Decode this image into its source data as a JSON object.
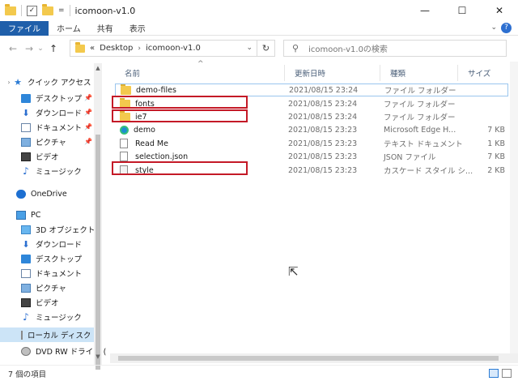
{
  "window": {
    "title": "icomoon-v1.0",
    "qat_arrow": "=",
    "minimize": "—",
    "maximize": "☐",
    "close": "✕"
  },
  "ribbon": {
    "tabs": [
      "ファイル",
      "ホーム",
      "共有",
      "表示"
    ],
    "collapse": "⌄",
    "help": "?"
  },
  "nav": {
    "back": "←",
    "forward": "→",
    "recent": "⌄",
    "up": "↑"
  },
  "address": {
    "overflow": "«",
    "crumbs": [
      "Desktop",
      "icomoon-v1.0"
    ],
    "separator": "›",
    "dropdown": "⌄",
    "refresh": "↻"
  },
  "search": {
    "icon": "⚲",
    "placeholder": "icomoon-v1.0の検索"
  },
  "sidebar": {
    "items": [
      {
        "label": "クイック アクセス",
        "icon": "star-icon",
        "chev": "›",
        "pin": ""
      },
      {
        "label": "デスクトップ",
        "icon": "desktop-icon",
        "chev": "",
        "pin": "📌"
      },
      {
        "label": "ダウンロード",
        "icon": "download-icon",
        "chev": "",
        "pin": "📌"
      },
      {
        "label": "ドキュメント",
        "icon": "documents-icon",
        "chev": "",
        "pin": "📌"
      },
      {
        "label": "ピクチャ",
        "icon": "pictures-icon",
        "chev": "",
        "pin": "📌"
      },
      {
        "label": "ビデオ",
        "icon": "videos-icon",
        "chev": "",
        "pin": ""
      },
      {
        "label": "ミュージック",
        "icon": "music-icon",
        "chev": "",
        "pin": ""
      },
      {
        "label": "OneDrive",
        "icon": "onedrive-icon",
        "chev": "",
        "pin": ""
      },
      {
        "label": "PC",
        "icon": "pc-icon",
        "chev": "",
        "pin": ""
      },
      {
        "label": "3D オブジェクト",
        "icon": "3d-objects-icon",
        "chev": "",
        "pin": ""
      },
      {
        "label": "ダウンロード",
        "icon": "download-icon",
        "chev": "",
        "pin": ""
      },
      {
        "label": "デスクトップ",
        "icon": "desktop-icon",
        "chev": "",
        "pin": ""
      },
      {
        "label": "ドキュメント",
        "icon": "documents-icon",
        "chev": "",
        "pin": ""
      },
      {
        "label": "ピクチャ",
        "icon": "pictures-icon",
        "chev": "",
        "pin": ""
      },
      {
        "label": "ビデオ",
        "icon": "videos-icon",
        "chev": "",
        "pin": ""
      },
      {
        "label": "ミュージック",
        "icon": "music-icon",
        "chev": "",
        "pin": ""
      },
      {
        "label": "ローカル ディスク (C",
        "icon": "local-disk-icon",
        "chev": "",
        "pin": ""
      },
      {
        "label": "DVD RW ドライブ (",
        "icon": "dvd-drive-icon",
        "chev": "",
        "pin": ""
      }
    ]
  },
  "columns": {
    "name": "名前",
    "date": "更新日時",
    "type": "種類",
    "size": "サイズ",
    "sort_caret": "^"
  },
  "files": [
    {
      "name": "demo-files",
      "date": "2021/08/15 23:24",
      "type": "ファイル フォルダー",
      "size": "",
      "kind": "folder"
    },
    {
      "name": "fonts",
      "date": "2021/08/15 23:24",
      "type": "ファイル フォルダー",
      "size": "",
      "kind": "folder"
    },
    {
      "name": "ie7",
      "date": "2021/08/15 23:24",
      "type": "ファイル フォルダー",
      "size": "",
      "kind": "folder"
    },
    {
      "name": "demo",
      "date": "2021/08/15 23:23",
      "type": "Microsoft Edge H...",
      "size": "7 KB",
      "kind": "edge"
    },
    {
      "name": "Read Me",
      "date": "2021/08/15 23:23",
      "type": "テキスト ドキュメント",
      "size": "1 KB",
      "kind": "text"
    },
    {
      "name": "selection.json",
      "date": "2021/08/15 23:23",
      "type": "JSON ファイル",
      "size": "7 KB",
      "kind": "text"
    },
    {
      "name": "style",
      "date": "2021/08/15 23:23",
      "type": "カスケード スタイル シ...",
      "size": "2 KB",
      "kind": "css"
    }
  ],
  "status": {
    "count": "7 個の項目"
  },
  "colors": {
    "accent": "#1f5faa",
    "highlight_box": "#c41a27",
    "selection_border": "#9ac6ee"
  }
}
